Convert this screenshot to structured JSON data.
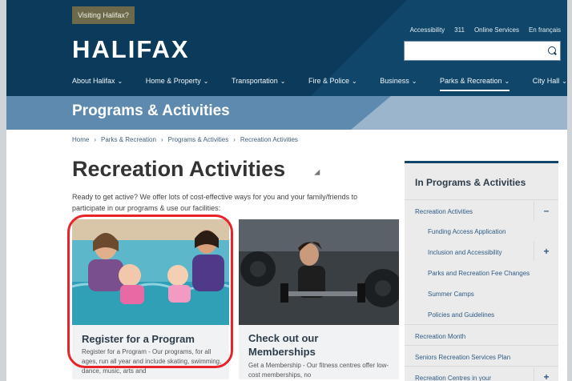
{
  "header": {
    "visiting_label": "Visiting Halifax?",
    "logo_text": "HALIFAX",
    "utility_links": [
      "Accessibility",
      "311",
      "Online Services",
      "En français"
    ],
    "search": {
      "placeholder": "",
      "value": ""
    }
  },
  "nav": {
    "items": [
      {
        "label": "About Halifax"
      },
      {
        "label": "Home & Property"
      },
      {
        "label": "Transportation"
      },
      {
        "label": "Fire & Police"
      },
      {
        "label": "Business"
      },
      {
        "label": "Parks & Recreation"
      },
      {
        "label": "City Hall"
      }
    ]
  },
  "section": {
    "title": "Programs & Activities"
  },
  "breadcrumb": [
    "Home",
    "Parks & Recreation",
    "Programs & Activities",
    "Recreation Activities"
  ],
  "page": {
    "title": "Recreation Activities",
    "intro": "Ready to get active? We offer lots of cost-effective ways for you and your family/friends to participate in our programs & use our facilities:"
  },
  "cards": [
    {
      "title": "Register for a Program",
      "desc": "Register for a Program - Our programs, for all ages, run all year and include skating, swimming, dance, music, arts and"
    },
    {
      "title": "Check out our Memberships",
      "desc": "Get a Membership - Our fitness centres offer low-cost memberships, no"
    }
  ],
  "sidebar": {
    "heading": "In Programs & Activities",
    "items": [
      {
        "label": "Recreation Activities",
        "level": 0,
        "toggle": "–"
      },
      {
        "label": "Funding Access Application",
        "level": 1
      },
      {
        "label": "Inclusion and Accessibility",
        "level": 1,
        "toggle": "+"
      },
      {
        "label": "Parks and Recreation Fee Changes",
        "level": 1
      },
      {
        "label": "Summer Camps",
        "level": 1
      },
      {
        "label": "Policies and Guidelines",
        "level": 1
      },
      {
        "label": "Recreation Month",
        "level": 0
      },
      {
        "label": "Seniors Recreation Services Plan",
        "level": 0
      },
      {
        "label": "Recreation Centres in your",
        "level": 0,
        "toggle": "+"
      }
    ]
  },
  "colors": {
    "brand_navy": "#0b3a5b",
    "title_bar": "#5f8ab0",
    "highlight": "#e8232a"
  },
  "icons": [
    "search-icon",
    "chevron-down-icon",
    "minus-icon",
    "plus-icon",
    "cursor-icon"
  ]
}
